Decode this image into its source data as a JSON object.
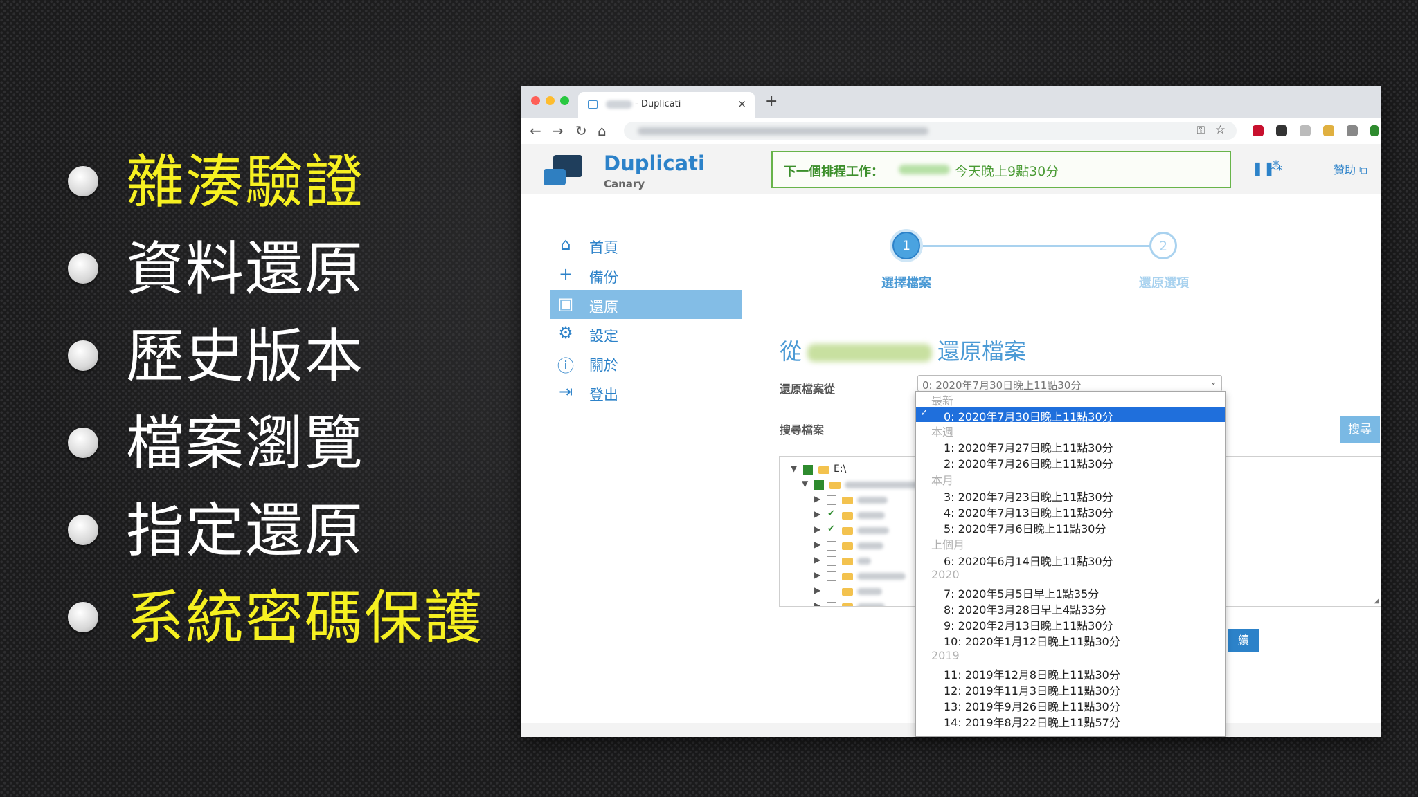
{
  "slide": {
    "bullets": [
      {
        "text": "雜湊驗證",
        "highlight": true
      },
      {
        "text": "資料還原",
        "highlight": false
      },
      {
        "text": "歷史版本",
        "highlight": false
      },
      {
        "text": "檔案瀏覽",
        "highlight": false
      },
      {
        "text": "指定還原",
        "highlight": false
      },
      {
        "text": "系統密碼保護",
        "highlight": true
      }
    ],
    "colors": {
      "highlight": "#f6f021",
      "normal": "#ffffff"
    }
  },
  "browser": {
    "tab_title": "- Duplicati",
    "close_glyph": "×",
    "new_tab_glyph": "+",
    "nav": {
      "back": "←",
      "forward": "→",
      "reload": "↻",
      "home": "⌂"
    },
    "omnibox": {
      "key_icon": "⚿",
      "star_icon": "☆"
    },
    "menu_glyph": "⋮"
  },
  "app": {
    "brand": "Duplicati",
    "channel": "Canary",
    "schedule_label": "下一個排程工作：",
    "schedule_time": "今天晚上9點30分",
    "pause_glyph": "❚❚",
    "throttle_glyph": "⁂",
    "help_label": "贊助 ⧉",
    "sidebar": [
      {
        "label": "首頁",
        "icon": "⌂"
      },
      {
        "label": "備份",
        "icon": "+"
      },
      {
        "label": "還原",
        "icon": "▣"
      },
      {
        "label": "設定",
        "icon": "⚙"
      },
      {
        "label": "關於",
        "icon": "ⓘ"
      },
      {
        "label": "登出",
        "icon": "⇥"
      }
    ],
    "steps": [
      {
        "number": "1",
        "label": "選擇檔案"
      },
      {
        "number": "2",
        "label": "還原選項"
      }
    ],
    "restore_title_prefix": "從",
    "restore_title_suffix": "還原檔案",
    "restore_from_label": "還原檔案從",
    "restore_from_value": "0: 2020年7月30日晚上11點30分",
    "search_label": "搜尋檔案",
    "search_button": "搜尋",
    "tree_root": "E:\\",
    "next_button": "續"
  },
  "dropdown": {
    "groups": [
      {
        "label": "最新",
        "options": [
          "0: 2020年7月30日晚上11點30分"
        ]
      },
      {
        "label": "本週",
        "options": [
          "1: 2020年7月27日晚上11點30分",
          "2: 2020年7月26日晚上11點30分"
        ]
      },
      {
        "label": "本月",
        "options": [
          "3: 2020年7月23日晚上11點30分",
          "4: 2020年7月13日晚上11點30分",
          "5: 2020年7月6日晚上11點30分"
        ]
      },
      {
        "label": "上個月",
        "options": [
          "6: 2020年6月14日晚上11點30分"
        ]
      },
      {
        "label": "2020",
        "options": [
          "7: 2020年5月5日早上1點35分",
          "8: 2020年3月28日早上4點33分",
          "9: 2020年2月13日晚上11點30分",
          "10: 2020年1月12日晚上11點30分"
        ]
      },
      {
        "label": "2019",
        "options": [
          "11: 2019年12月8日晚上11點30分",
          "12: 2019年11月3日晚上11點30分",
          "13: 2019年9月26日晚上11點30分",
          "14: 2019年8月22日晚上11點57分"
        ]
      }
    ],
    "selected_index": 0,
    "check_glyph": "✓",
    "selection_color": "#1f6fdc"
  }
}
